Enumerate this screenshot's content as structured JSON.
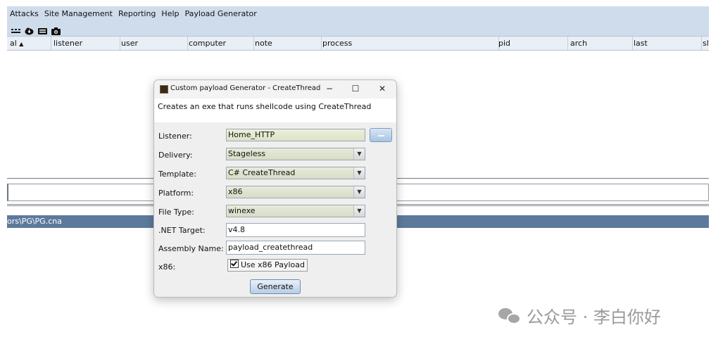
{
  "menubar": {
    "items": [
      "Attacks",
      "Site Management",
      "Reporting",
      "Help",
      "Payload Generator"
    ]
  },
  "toolbar": {
    "icons": [
      "grid-icon",
      "cloud-download-icon",
      "keyboard-icon",
      "camera-icon"
    ]
  },
  "table": {
    "columns": [
      "al",
      "listener",
      "user",
      "computer",
      "note",
      "process",
      "pid",
      "arch",
      "last",
      "sl"
    ]
  },
  "tabstrip": {
    "label": "ors\\PG\\PG.cna"
  },
  "dialog": {
    "title": "Custom payload Generator - CreateThread",
    "description": "Creates an exe that runs shellcode using CreateThread",
    "fields": {
      "listener_label": "Listener:",
      "listener_value": "Home_HTTP",
      "delivery_label": "Delivery:",
      "delivery_value": "Stageless",
      "template_label": "Template:",
      "template_value": "C# CreateThread",
      "platform_label": "Platform:",
      "platform_value": "x86",
      "filetype_label": "File Type:",
      "filetype_value": "winexe",
      "nettarget_label": ".NET Target:",
      "nettarget_value": "v4.8",
      "assembly_label": "Assembly Name:",
      "assembly_value": "payload_createthread",
      "x86_label": "x86:",
      "x86_checkbox_label": "Use x86 Payload"
    },
    "generate_label": "Generate",
    "window_controls": {
      "minimize": "−",
      "maximize": "☐",
      "close": "✕"
    }
  },
  "watermark": {
    "text": "公众号 · 李白你好"
  },
  "colors": {
    "menubar_bg": "#cfdcec",
    "tabstrip_bg": "#5d7a9c"
  }
}
